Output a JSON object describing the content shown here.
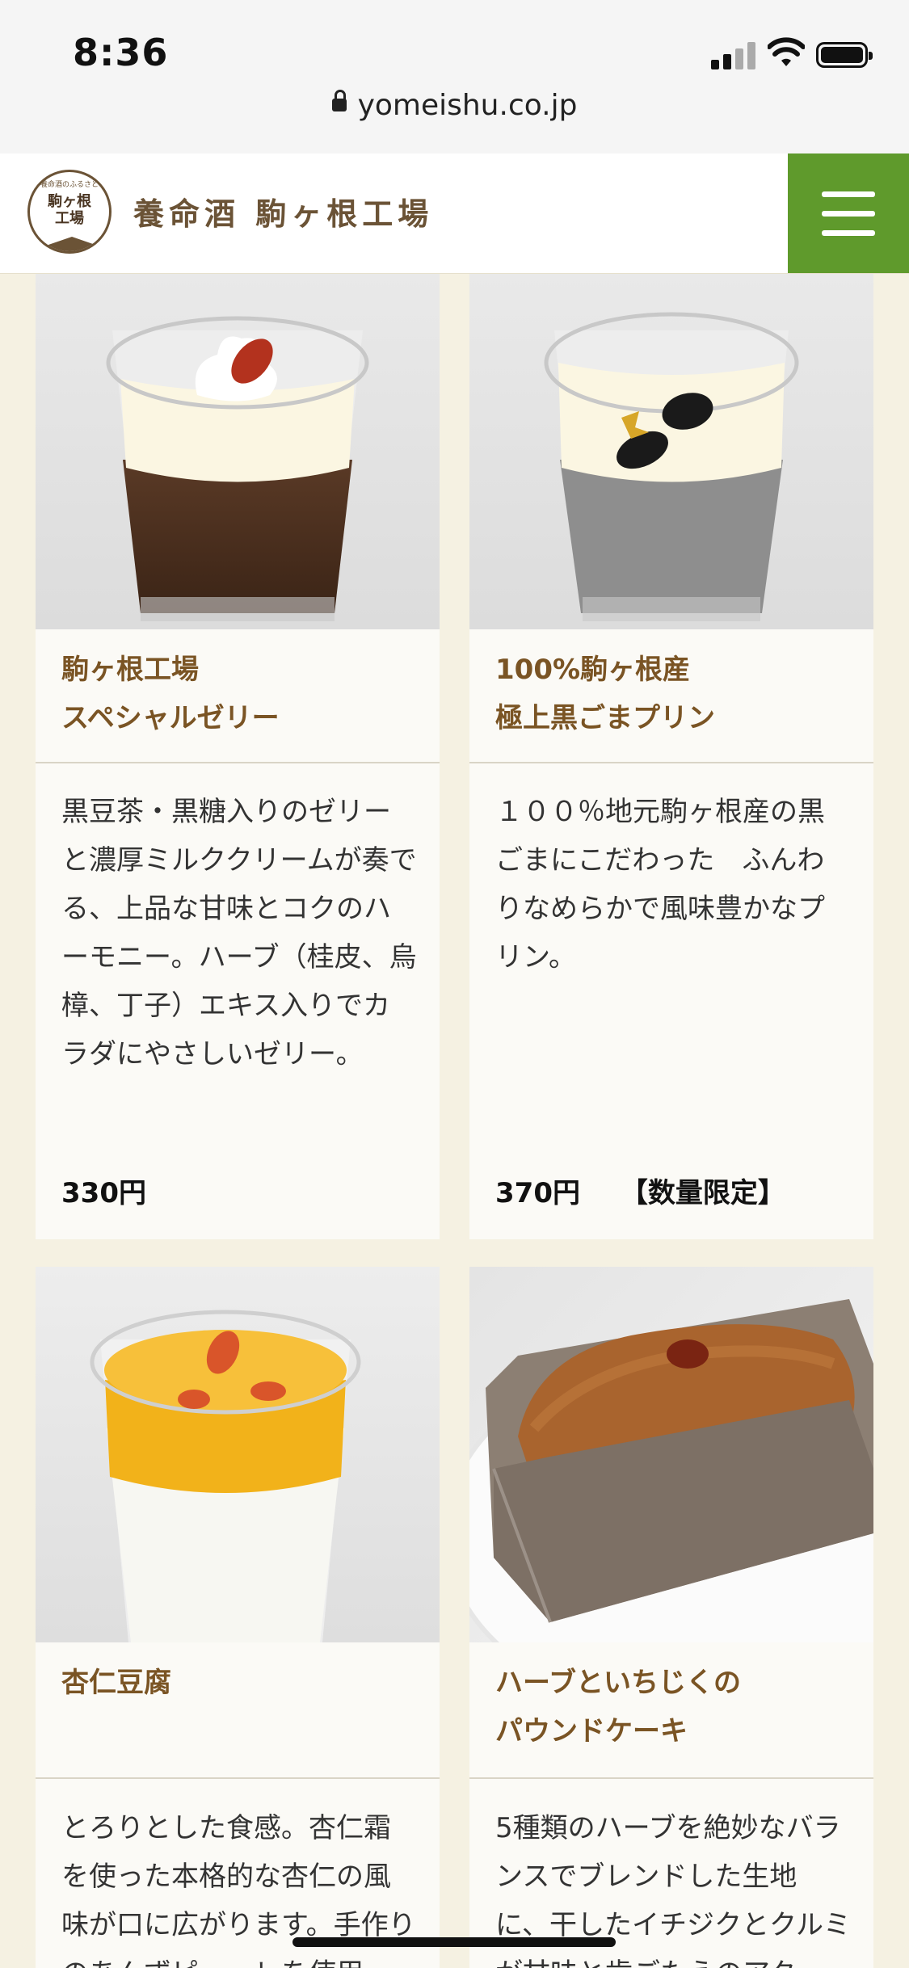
{
  "status": {
    "time": "8:36"
  },
  "browser": {
    "url": "yomeishu.co.jp"
  },
  "header": {
    "logo_arc": "養命酒のふるさと",
    "logo_name_1": "駒ヶ根",
    "logo_name_2": "工場",
    "title": "養命酒 駒ヶ根工場"
  },
  "products": [
    {
      "title_line1": "駒ヶ根工場",
      "title_line2": "スペシャルゼリー",
      "description": "黒豆茶・黒糖入りのゼリーと濃厚ミルククリームが奏でる、上品な甘味とコクのハーモニー。ハーブ（桂皮、烏樟、丁子）エキス入りでカラダにやさしいゼリー。",
      "price": "330円",
      "note": "",
      "image_icon": "jelly-cup-image"
    },
    {
      "title_line1": "100%駒ヶ根産",
      "title_line2": "極上黒ごまプリン",
      "description": "１００％地元駒ヶ根産の黒ごまにこだわった　ふんわりなめらかで風味豊かなプリン。",
      "price": "370円",
      "note": "【数量限定】",
      "image_icon": "sesame-pudding-image"
    },
    {
      "title_line1": "杏仁豆腐",
      "title_line2": "",
      "description": "とろりとした食感。杏仁霜を使った本格的な杏仁の風味が口に広がります。手作りのあんずピューレを使用",
      "price": "",
      "note": "",
      "image_icon": "almond-tofu-image"
    },
    {
      "title_line1": "ハーブといちじくの",
      "title_line2": "パウンドケーキ",
      "description": "5種類のハーブを絶妙なバランスでブレンドした生地に、干したイチジクとクルミが甘味と歯ごたえのアク",
      "price": "",
      "note": "",
      "image_icon": "pound-cake-image"
    }
  ],
  "colors": {
    "accent_green": "#5f9a2c",
    "title_brown": "#7a5424",
    "page_bg": "#f5f1e2"
  }
}
